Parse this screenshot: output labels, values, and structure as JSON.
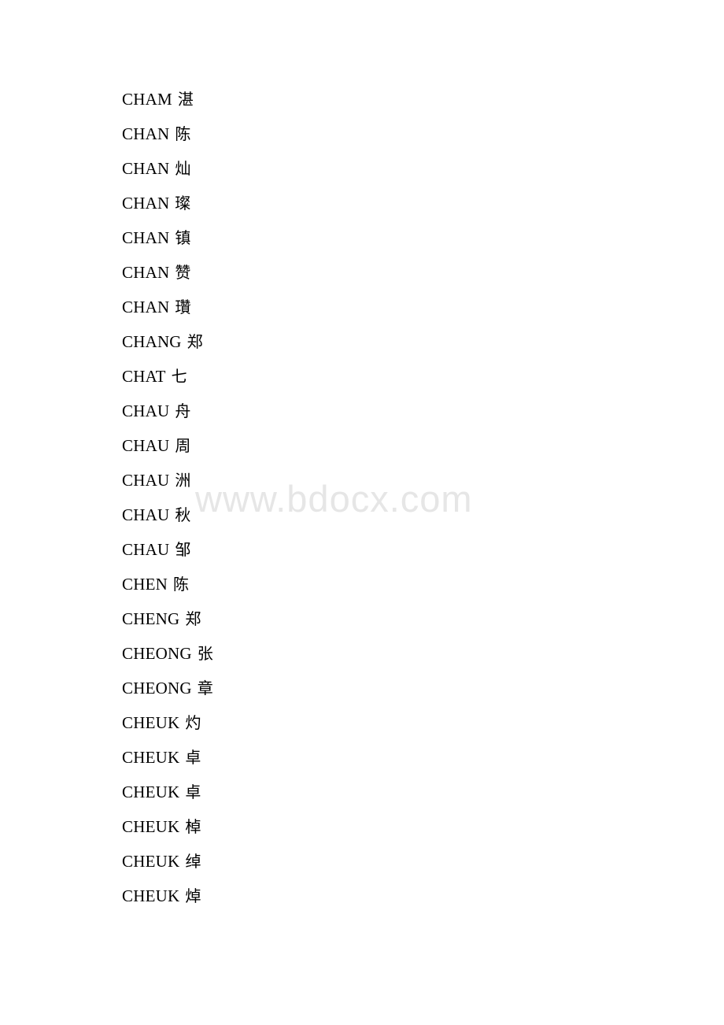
{
  "page": {
    "background_color": "#ffffff",
    "text_color": "#000000"
  },
  "watermark": {
    "text": "www.bdocx.com",
    "color": "#e6e6e6"
  },
  "entry_list": [
    {
      "romanization": "CHAM",
      "character": "湛"
    },
    {
      "romanization": "CHAN",
      "character": "陈"
    },
    {
      "romanization": "CHAN",
      "character": "灿"
    },
    {
      "romanization": "CHAN",
      "character": "璨"
    },
    {
      "romanization": "CHAN",
      "character": "镇"
    },
    {
      "romanization": "CHAN",
      "character": "赞"
    },
    {
      "romanization": "CHAN",
      "character": "瓚"
    },
    {
      "romanization": "CHANG",
      "character": "郑"
    },
    {
      "romanization": "CHAT",
      "character": "七"
    },
    {
      "romanization": "CHAU",
      "character": "舟"
    },
    {
      "romanization": "CHAU",
      "character": "周"
    },
    {
      "romanization": "CHAU",
      "character": "洲"
    },
    {
      "romanization": "CHAU",
      "character": "秋"
    },
    {
      "romanization": "CHAU",
      "character": "邹"
    },
    {
      "romanization": "CHEN",
      "character": "陈"
    },
    {
      "romanization": "CHENG",
      "character": "郑"
    },
    {
      "romanization": "CHEONG",
      "character": "张"
    },
    {
      "romanization": "CHEONG",
      "character": "章"
    },
    {
      "romanization": "CHEUK",
      "character": "灼"
    },
    {
      "romanization": "CHEUK",
      "character": "卓"
    },
    {
      "romanization": "CHEUK",
      "character": "卓"
    },
    {
      "romanization": "CHEUK",
      "character": "棹"
    },
    {
      "romanization": "CHEUK",
      "character": "绰"
    },
    {
      "romanization": "CHEUK",
      "character": "焯"
    }
  ]
}
